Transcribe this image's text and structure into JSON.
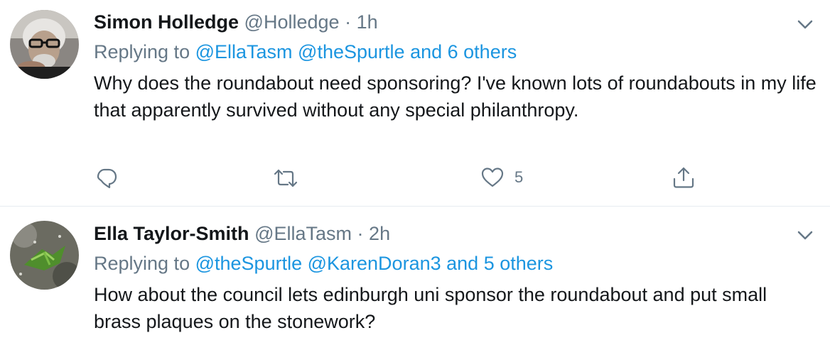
{
  "tweets": [
    {
      "name": "Simon Holledge",
      "handle": "@Holledge",
      "separator": "·",
      "time": "1h",
      "replying_prefix": "Replying to",
      "mentions": "@EllaTasm @theSpurtle",
      "others_conjunction": "and",
      "others": "6 others",
      "text": "Why does the roundabout need sponsoring? I've known lots of roundabouts in my life that apparently survived without any special philanthropy.",
      "actions": {
        "reply_icon": "reply-icon",
        "retweet_icon": "retweet-icon",
        "like_icon": "heart-icon",
        "like_count": "5",
        "share_icon": "share-icon"
      }
    },
    {
      "name": "Ella Taylor-Smith",
      "handle": "@EllaTasm",
      "separator": "·",
      "time": "2h",
      "replying_prefix": "Replying to",
      "mentions": "@theSpurtle @KarenDoran3",
      "others_conjunction": "and",
      "others": "5 others",
      "text": "How about the council lets edinburgh uni sponsor the roundabout and put small brass plaques on the stonework?"
    }
  ],
  "colors": {
    "link": "#1b95e0",
    "secondary_text": "#657786",
    "primary_text": "#14171a",
    "divider": "#e6ecf0"
  }
}
